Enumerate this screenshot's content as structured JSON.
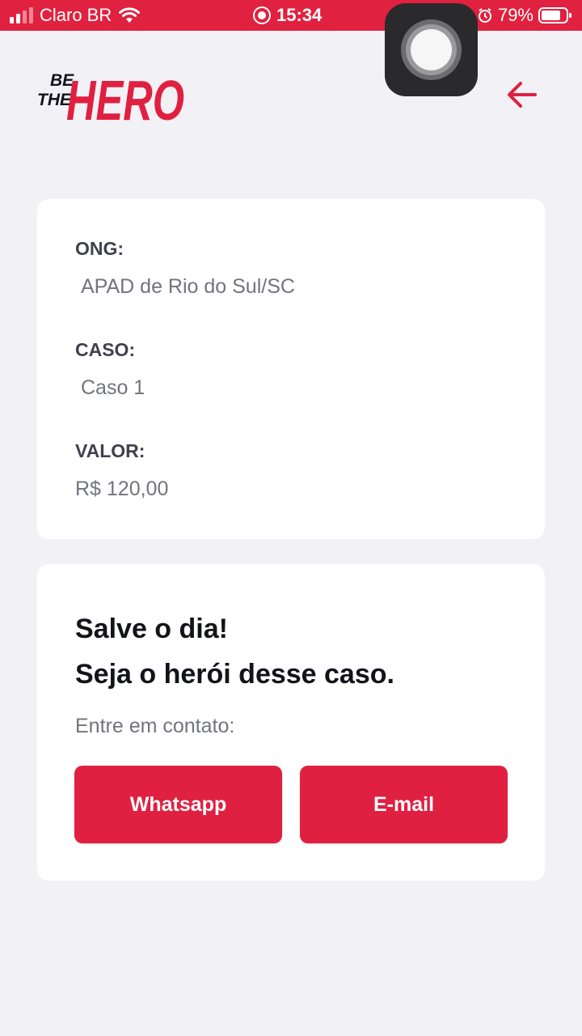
{
  "status_bar": {
    "carrier": "Claro BR",
    "time": "15:34",
    "battery": "79%",
    "battery_level": 0.79,
    "background_color": "#e0213f"
  },
  "header": {
    "logo_line1": "BE",
    "logo_line2": "THE",
    "logo_word": "HERO",
    "brand_color": "#e02041",
    "back_icon": "arrow-left-icon"
  },
  "incident": {
    "ong_label": "ONG:",
    "ong_value": "APAD de Rio do Sul/SC",
    "case_label": "CASO:",
    "case_value": "Caso 1",
    "value_label": "VALOR:",
    "value_value": "R$ 120,00"
  },
  "contact": {
    "title_line1": "Salve o dia!",
    "title_line2": "Seja o herói desse caso.",
    "description": "Entre em contato:",
    "whatsapp_label": "Whatsapp",
    "email_label": "E-mail"
  }
}
